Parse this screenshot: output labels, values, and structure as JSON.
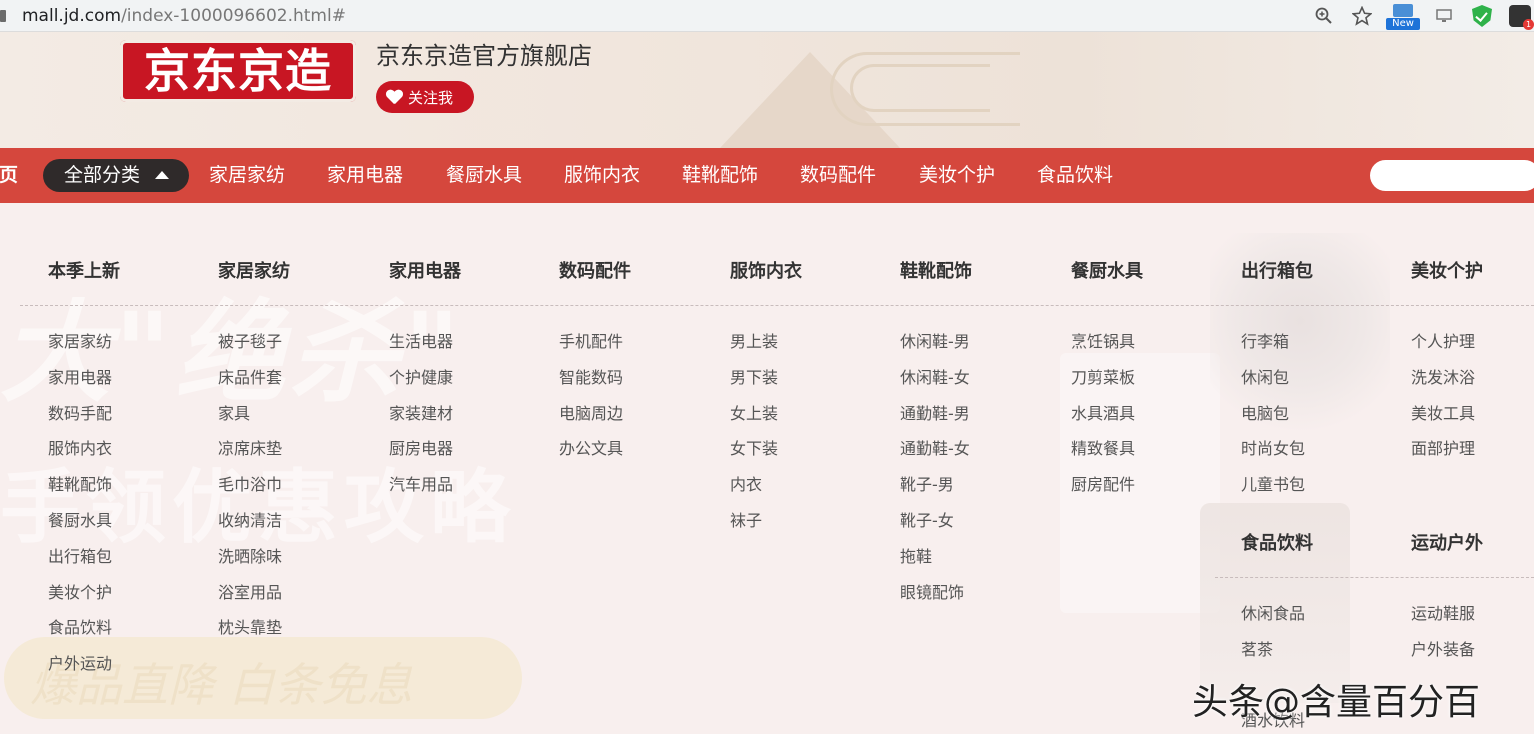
{
  "browser": {
    "url_host": "mall.jd.com",
    "url_path": "/index-1000096602.html#",
    "new_badge": "New"
  },
  "shop": {
    "logo_text": "京东京造",
    "title": "京东京造官方旗舰店",
    "follow_label": "关注我"
  },
  "nav": {
    "home": "首页",
    "all_categories": "全部分类",
    "items": [
      "家居家纺",
      "家用电器",
      "餐厨水具",
      "服饰内衣",
      "鞋靴配饰",
      "数码配件",
      "美妆个护",
      "食品饮料"
    ]
  },
  "background_text": {
    "line1": "大\"绝杀\"",
    "line2": "手领优惠攻略",
    "pill": "爆品直降  白条免息"
  },
  "dropdown": {
    "columns": [
      {
        "title": "本季上新",
        "items": [
          "家居家纺",
          "家用电器",
          "数码手配",
          "服饰内衣",
          "鞋靴配饰",
          "餐厨水具",
          "出行箱包",
          "美妆个护",
          "食品饮料",
          "户外运动"
        ]
      },
      {
        "title": "家居家纺",
        "items": [
          "被子毯子",
          "床品件套",
          "家具",
          "凉席床垫",
          "毛巾浴巾",
          "收纳清洁",
          "洗晒除味",
          "浴室用品",
          "枕头靠垫"
        ]
      },
      {
        "title": "家用电器",
        "items": [
          "生活电器",
          "个护健康",
          "家装建材",
          "厨房电器",
          "汽车用品"
        ]
      },
      {
        "title": "数码配件",
        "items": [
          "手机配件",
          "智能数码",
          "电脑周边",
          "办公文具"
        ]
      },
      {
        "title": "服饰内衣",
        "items": [
          "男上装",
          "男下装",
          "女上装",
          "女下装",
          "内衣",
          "袜子"
        ]
      },
      {
        "title": "鞋靴配饰",
        "items": [
          "休闲鞋-男",
          "休闲鞋-女",
          "通勤鞋-男",
          "通勤鞋-女",
          "靴子-男",
          "靴子-女",
          "拖鞋",
          "眼镜配饰"
        ]
      },
      {
        "title": "餐厨水具",
        "items": [
          "烹饪锅具",
          "刀剪菜板",
          "水具酒具",
          "精致餐具",
          "厨房配件"
        ]
      },
      {
        "title": "出行箱包",
        "items": [
          "行李箱",
          "休闲包",
          "电脑包",
          "时尚女包",
          "儿童书包"
        ]
      },
      {
        "title": "美妆个护",
        "items": [
          "个人护理",
          "洗发沐浴",
          "美妆工具",
          "面部护理"
        ]
      }
    ],
    "second_columns": [
      {
        "title": "食品饮料",
        "items": [
          "休闲食品",
          "茗茶",
          "",
          "酒水饮料"
        ]
      },
      {
        "title": "运动户外",
        "items": [
          "运动鞋服",
          "户外装备",
          ""
        ]
      }
    ]
  },
  "watermark": "头条@含量百分百"
}
